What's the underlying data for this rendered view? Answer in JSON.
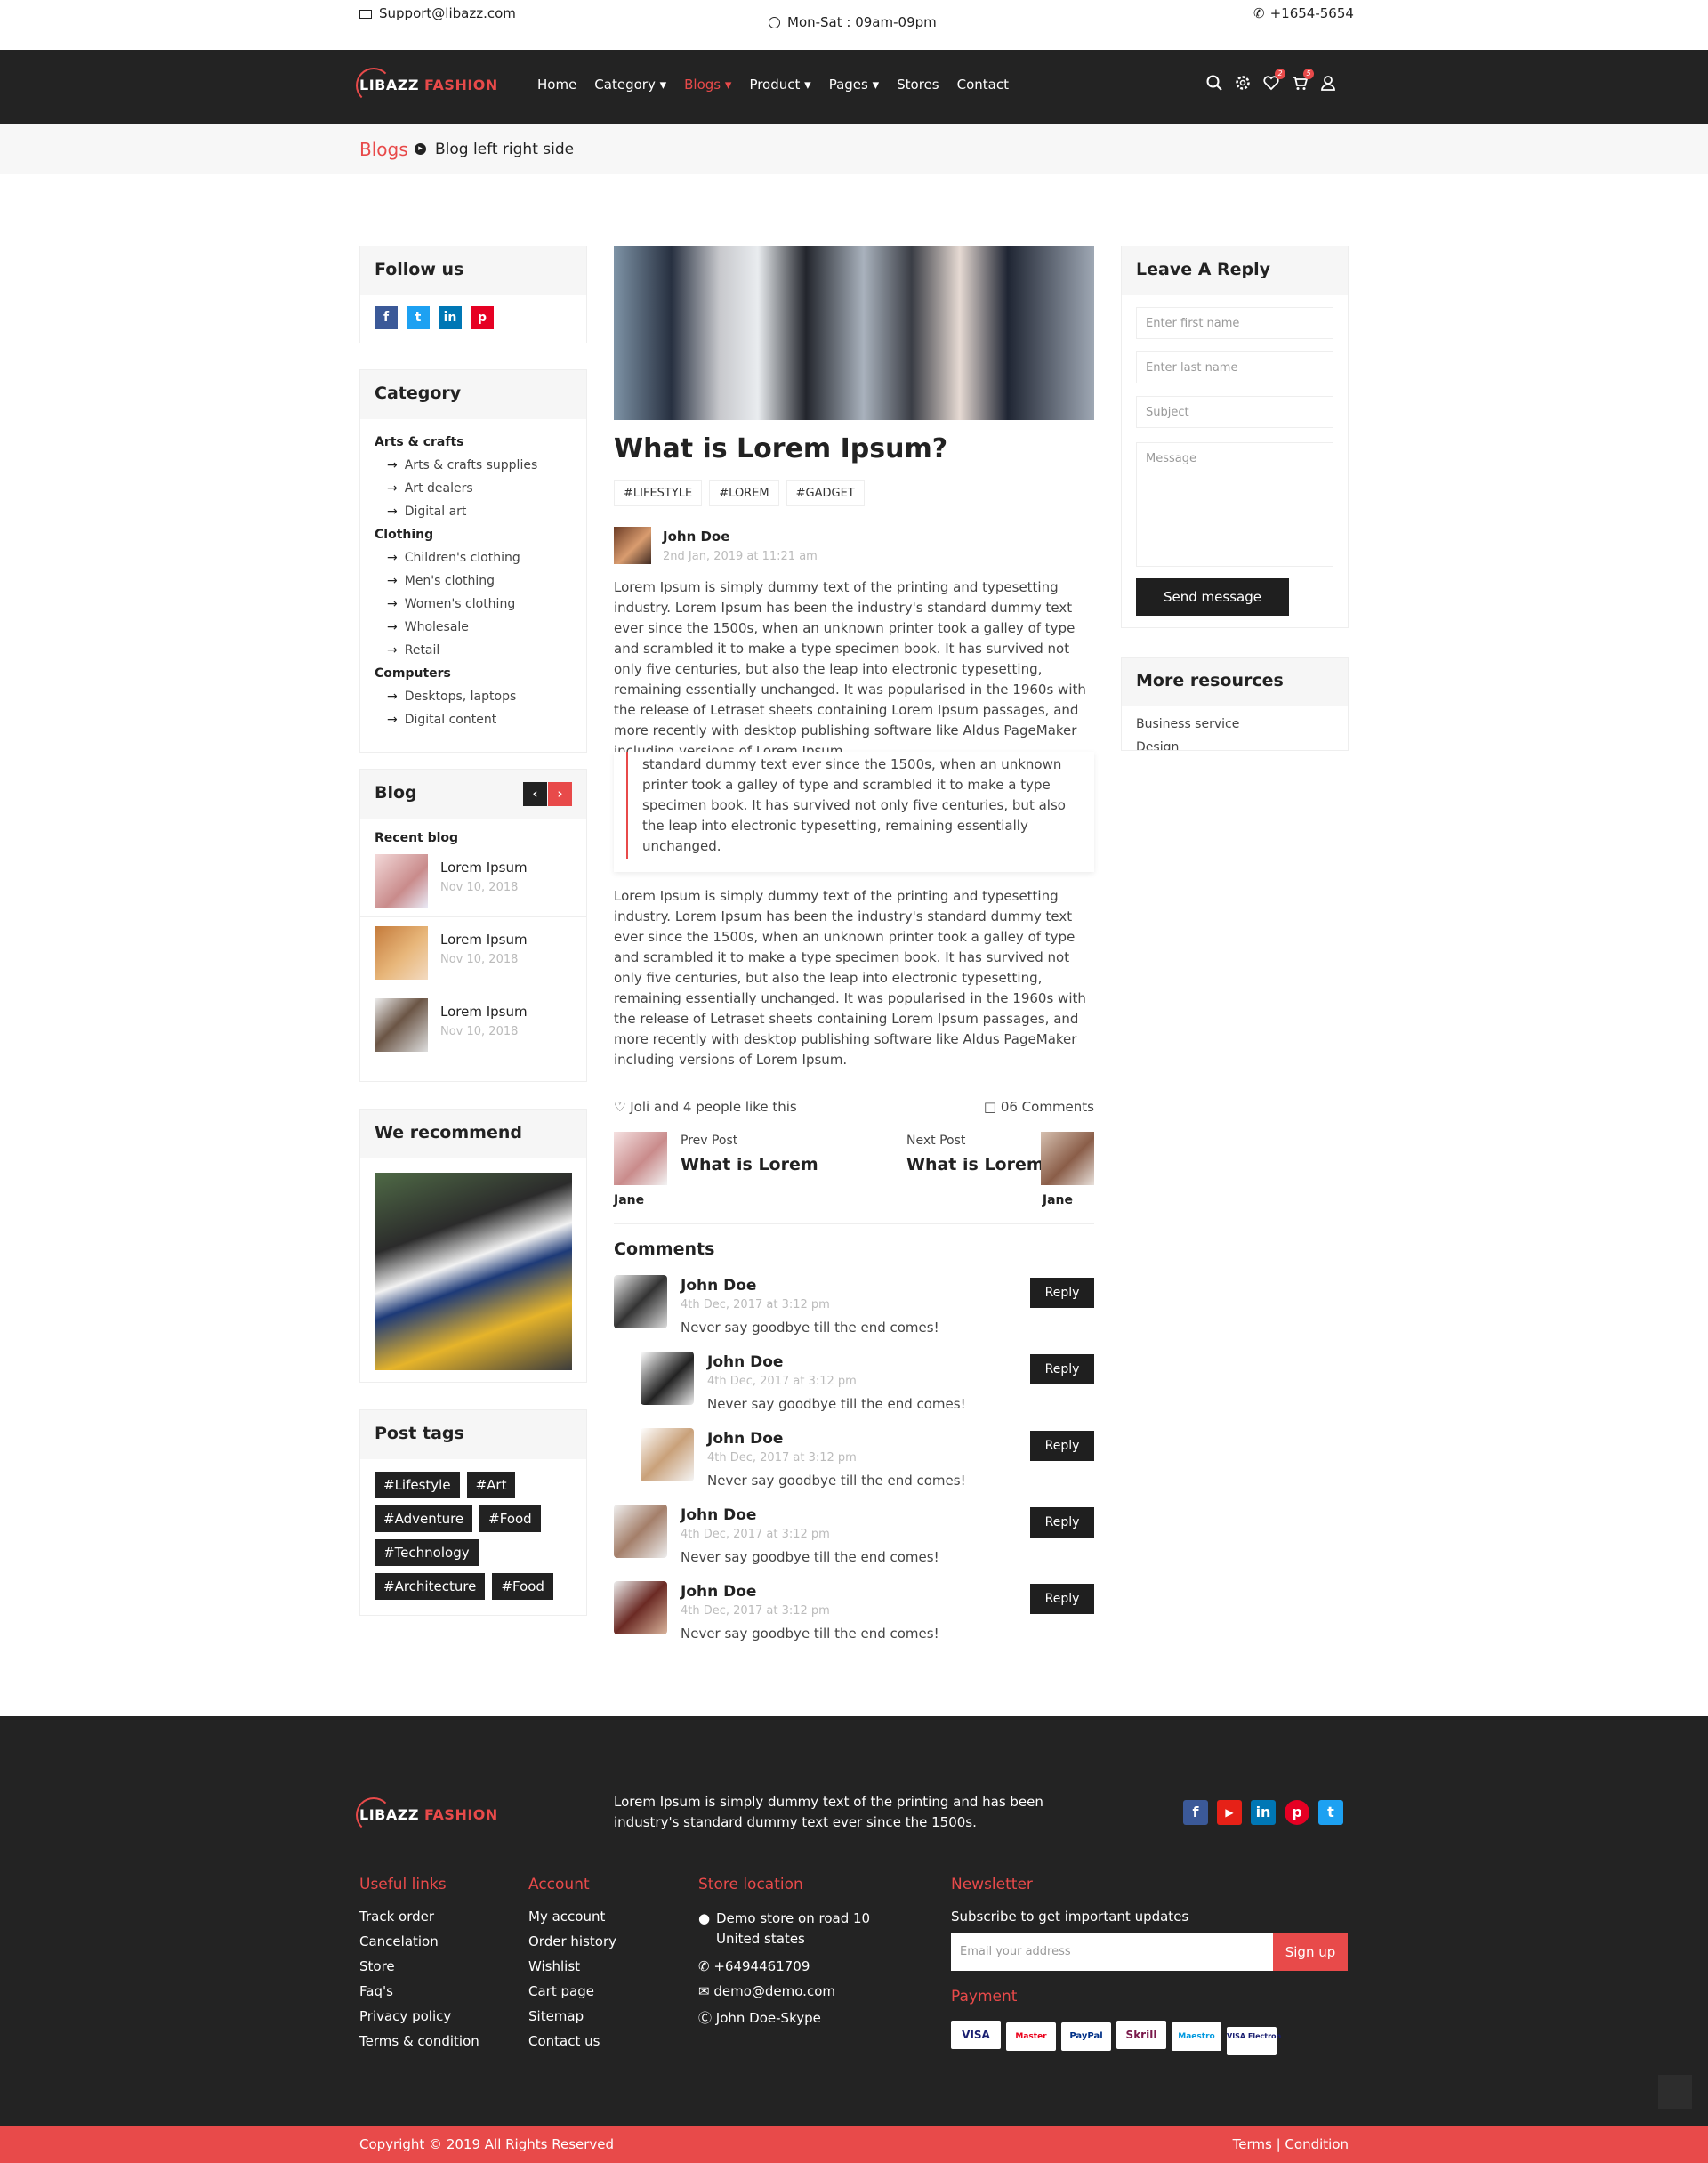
{
  "topbar": {
    "email": "Support@libazz.com",
    "hours": "Mon-Sat : 09am-09pm",
    "phone": "+1654-5654"
  },
  "brand": {
    "name_left": "LIBAZZ",
    "name_right": "FASHION"
  },
  "nav": {
    "items": [
      "Home",
      "Category",
      "Blogs",
      "Product",
      "Pages",
      "Stores",
      "Contact"
    ],
    "active": "Blogs",
    "wishlist_count": "2",
    "cart_count": "5"
  },
  "breadcrumb": {
    "parent": "Blogs",
    "current": "Blog left right side"
  },
  "sidebar": {
    "follow_title": "Follow us",
    "category_title": "Category",
    "categories": [
      {
        "name": "Arts & crafts",
        "subs": [
          "Arts & crafts supplies",
          "Art dealers",
          "Digital art"
        ]
      },
      {
        "name": "Clothing",
        "subs": [
          "Children's clothing",
          "Men's clothing",
          "Women's clothing",
          "Wholesale",
          "Retail"
        ]
      },
      {
        "name": "Computers",
        "subs": [
          "Desktops, laptops",
          "Digital content"
        ]
      }
    ],
    "blog_title": "Blog",
    "recent_title": "Recent blog",
    "recent": [
      {
        "title": "Lorem Ipsum",
        "date": "Nov 10, 2018"
      },
      {
        "title": "Lorem Ipsum",
        "date": "Nov 10, 2018"
      },
      {
        "title": "Lorem Ipsum",
        "date": "Nov 10, 2018"
      }
    ],
    "recommend_title": "We recommend",
    "tags_title": "Post tags",
    "tags": [
      "#Lifestyle",
      "#Art",
      "#Adventure",
      "#Food",
      "#Technology",
      "#Architecture",
      "#Food"
    ]
  },
  "post": {
    "title": "What is Lorem Ipsum?",
    "tags": [
      "#LIFESTYLE",
      "#LOREM",
      "#GADGET"
    ],
    "author": "John Doe",
    "date": "2nd Jan, 2019 at 11:21 am",
    "para1": "Lorem Ipsum is simply dummy text of the printing and typesetting industry. Lorem Ipsum has been the industry's standard dummy text ever since the 1500s, when an unknown printer took a galley of type and scrambled it to make a type specimen book. It has survived not only five centuries, but also the leap into electronic typesetting, remaining essentially unchanged. It was popularised in the 1960s with the release of Letraset sheets containing Lorem Ipsum passages, and more recently with desktop publishing software like Aldus PageMaker including versions of Lorem Ipsum.",
    "quote": "standard dummy text ever since the 1500s, when an unknown printer took a galley of type and scrambled it to make a type specimen book. It has survived not only five centuries, but also the leap into electronic typesetting, remaining essentially unchanged.",
    "para2": "Lorem Ipsum is simply dummy text of the printing and typesetting industry. Lorem Ipsum has been the industry's standard dummy text ever since the 1500s, when an unknown printer took a galley of type and scrambled it to make a type specimen book. It has survived not only five centuries, but also the leap into electronic typesetting, remaining essentially unchanged. It was popularised in the 1960s with the release of Letraset sheets containing Lorem Ipsum passages, and more recently with desktop publishing software like Aldus PageMaker including versions of Lorem Ipsum.",
    "likes": "Joli and 4 people like this",
    "comments_count": "06 Comments",
    "prev_label": "Prev Post",
    "prev_title": "What is Lorem",
    "prev_author": "Jane",
    "next_label": "Next Post",
    "next_title": "What is Lorem",
    "next_author": "Jane"
  },
  "comments": {
    "title": "Comments",
    "reply_label": "Reply",
    "items": [
      {
        "name": "John Doe",
        "date": "4th Dec, 2017 at 3:12 pm",
        "text": "Never say goodbye till the end comes!"
      },
      {
        "name": "John Doe",
        "date": "4th Dec, 2017 at 3:12 pm",
        "text": "Never say goodbye till the end comes!"
      },
      {
        "name": "John Doe",
        "date": "4th Dec, 2017 at 3:12 pm",
        "text": "Never say goodbye till the end comes!"
      },
      {
        "name": "John Doe",
        "date": "4th Dec, 2017 at 3:12 pm",
        "text": "Never say goodbye till the end comes!"
      },
      {
        "name": "John Doe",
        "date": "4th Dec, 2017 at 3:12 pm",
        "text": "Never say goodbye till the end comes!"
      }
    ]
  },
  "reply": {
    "title": "Leave A Reply",
    "first": "Enter first name",
    "last": "Enter last name",
    "subject": "Subject",
    "message": "Message",
    "button": "Send message"
  },
  "resources": {
    "title": "More resources",
    "items": [
      "Business service",
      "Design"
    ]
  },
  "footer": {
    "about": "Lorem Ipsum is simply dummy text of the printing and has been industry's standard dummy text ever since the 1500s.",
    "useful_title": "Useful links",
    "useful": [
      "Track order",
      "Cancelation",
      "Store",
      "Faq's",
      "Privacy policy",
      "Terms & condition"
    ],
    "account_title": "Account",
    "account": [
      "My account",
      "Order history",
      "Wishlist",
      "Cart page",
      "Sitemap",
      "Contact us"
    ],
    "store_title": "Store location",
    "address": "Demo store on road 10 United states",
    "phone": "+6494461709",
    "email": "demo@demo.com",
    "skype": "John Doe-Skype",
    "news_title": "Newsletter",
    "news_sub": "Subscribe to get important updates",
    "news_placeholder": "Email your address",
    "signup": "Sign up",
    "payment_title": "Payment",
    "payments": [
      "VISA",
      "Master",
      "PayPal",
      "Skrill",
      "Maestro",
      "VISA Electron"
    ]
  },
  "copyright": "Copyright © 2019 All Rights Reserved",
  "terms": "Terms | Condition",
  "colors": {
    "accent": "#e84a4a",
    "dark": "#232323"
  }
}
